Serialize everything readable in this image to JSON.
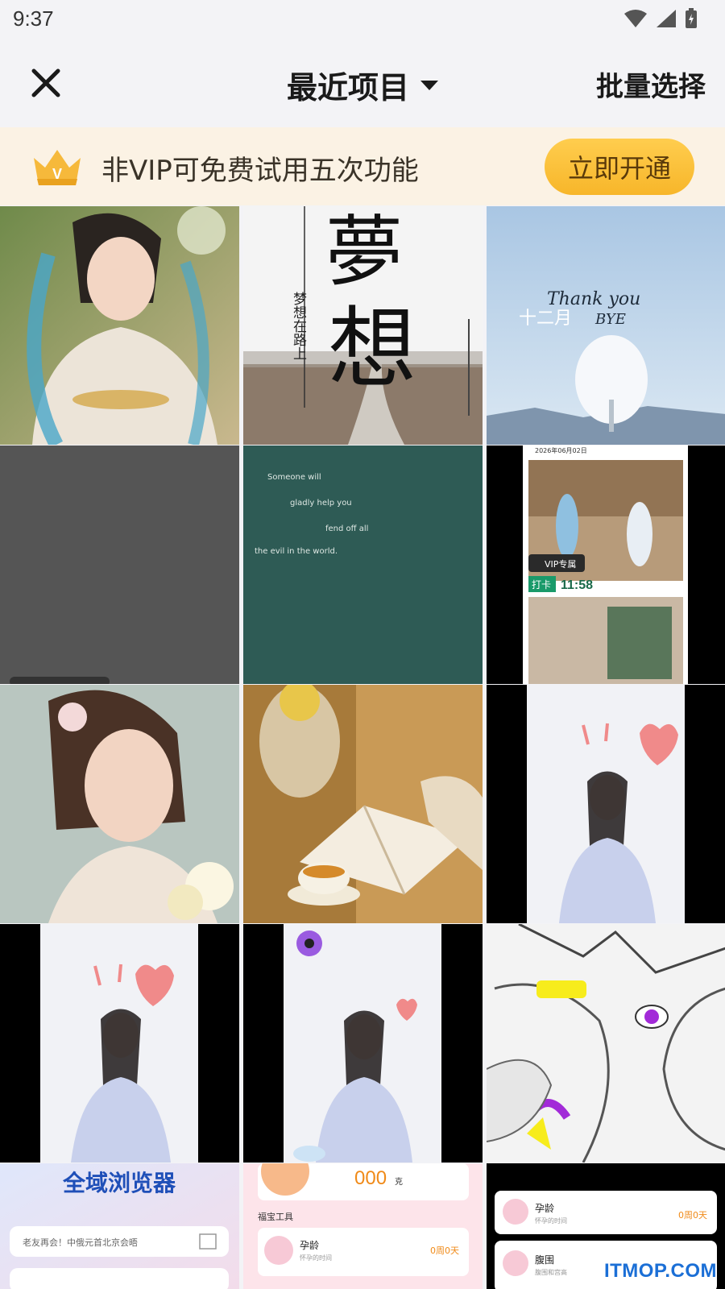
{
  "status": {
    "time": "9:37"
  },
  "header": {
    "title": "最近项目",
    "batch_select": "批量选择"
  },
  "vip_banner": {
    "text": "非VIP可免费试用五次功能",
    "button": "立即开通",
    "crown_letter": "V"
  },
  "tiles": {
    "poster_dream": {
      "big1": "夢",
      "big2": "想",
      "vertical": "梦想在路上"
    },
    "december": {
      "line1": "Thank you",
      "line2": "十二月",
      "line3": "BYE"
    },
    "quote": {
      "l1": "Someone will",
      "l2": "gladly help you",
      "l3": "fend off all",
      "l4": "the evil in the world."
    },
    "checkin": {
      "date": "2026年06月02日",
      "badge": "VIP专属",
      "punch": "打卡",
      "time": "11:58"
    },
    "browser": {
      "title": "全域浏览器",
      "search": "老友再会！中俄元首北京会晤"
    },
    "pregnancy1": {
      "number": "000",
      "unit": "克",
      "section": "福宝工具",
      "item": "孕龄",
      "sub": "怀孕的时间",
      "value": "0周0天"
    },
    "pregnancy2": {
      "item1": "孕龄",
      "sub1": "怀孕的时间",
      "value1": "0周0天",
      "item2": "腹围",
      "sub2": "腹围和宫高"
    }
  },
  "watermark": "ITMOP.COM"
}
